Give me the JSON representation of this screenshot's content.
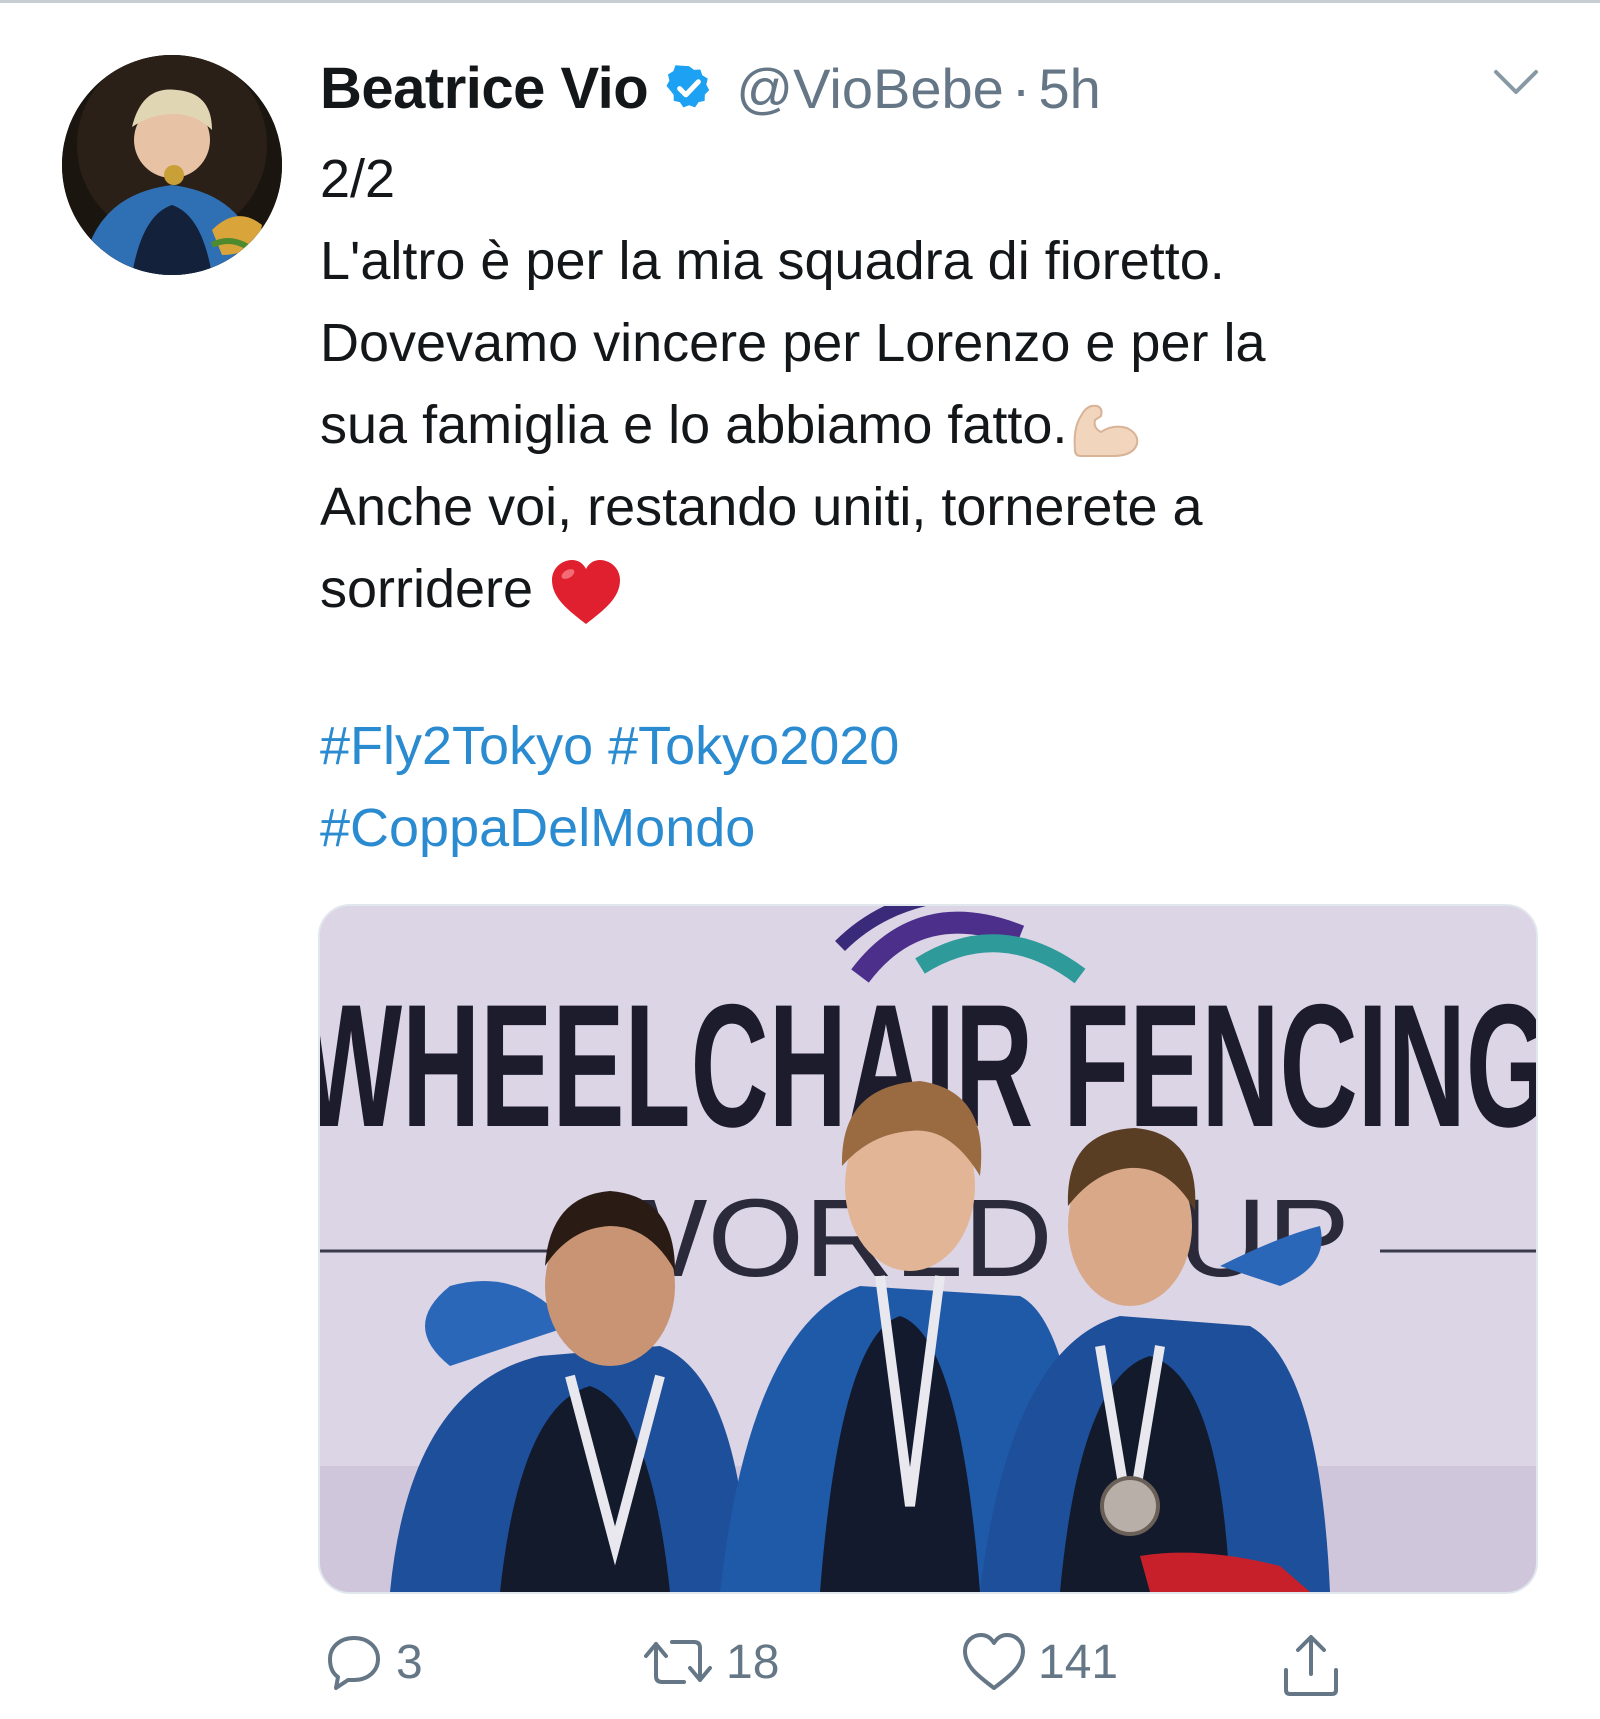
{
  "tweet": {
    "author_name": "Beatrice Vio",
    "handle": "@VioBebe",
    "separator": "·",
    "time": "5h",
    "lines": [
      "2/2",
      "L'altro è per la mia squadra di fioretto.",
      "Dovevamo vincere per Lorenzo e per la",
      "sua famiglia e lo abbiamo fatto.",
      "Anche voi, restando uniti, tornerete a",
      "sorridere"
    ],
    "hashtag_lines": [
      "#Fly2Tokyo #Tokyo2020",
      "#CoppaDelMondo"
    ],
    "emojis": {
      "line4": "flexed-biceps",
      "line6": "red-heart"
    },
    "media": {
      "banner_text": "WHEELCHAIR FENCING",
      "banner_subtext": "WORLD CUP"
    }
  },
  "actions": {
    "reply_count": "3",
    "retweet_count": "18",
    "like_count": "141"
  },
  "colors": {
    "link": "#2b8bd1",
    "verified": "#1da1f2",
    "muted": "#657786",
    "text": "#14171a"
  }
}
